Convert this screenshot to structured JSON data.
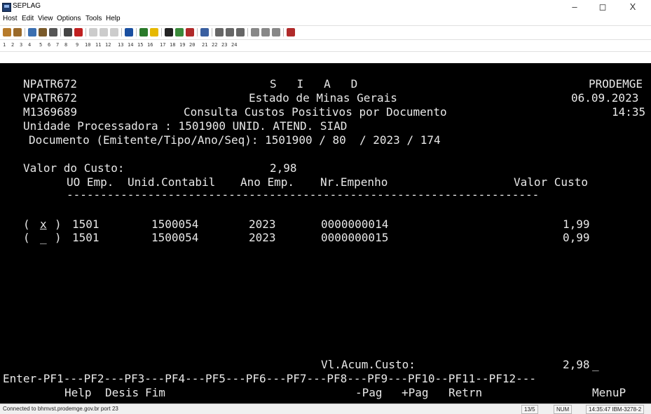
{
  "window": {
    "title": "SEPLAG",
    "minimize": "–",
    "maximize": "◻",
    "close": "X"
  },
  "menu": [
    "Host",
    "Edit",
    "View",
    "Options",
    "Tools",
    "Help"
  ],
  "pf_keys": [
    "1",
    "2",
    "3",
    "4",
    "5",
    "6",
    "7",
    "8",
    "9",
    "10",
    "11",
    "12",
    "13",
    "14",
    "15",
    "16",
    "17",
    "18",
    "19",
    "20",
    "21",
    "22",
    "23",
    "24"
  ],
  "screen": {
    "program": "NPATR672",
    "app_name": "S   I   A   D",
    "company": "PRODEMGE",
    "view_id": "VPATR672",
    "state": "Estado de Minas Gerais",
    "date": "06.09.2023",
    "user_id": "M1369689",
    "screen_title": "Consulta Custos Positivos por Documento",
    "time": "14:35",
    "unit_line": "Unidade Processadora : 1501900 UNID. ATEND. SIAD",
    "document_line": "Documento (Emitente/Tipo/Ano/Seq): 1501900 / 80  / 2023 / 174",
    "valor_label": "Valor do Custo:",
    "valor_value": "2,98",
    "columns": {
      "uo": "UO Emp.",
      "unid": "Unid.Contabil",
      "ano": "Ano Emp.",
      "empenho": "Nr.Empenho",
      "valor": "Valor Custo"
    },
    "dashes": "----------------------------------------------------------------------",
    "rows": [
      {
        "sel": "x",
        "uo": "1501",
        "unid": "1500054",
        "ano": "2023",
        "empenho": "0000000014",
        "valor": "1,99"
      },
      {
        "sel": "_",
        "uo": "1501",
        "unid": "1500054",
        "ano": "2023",
        "empenho": "0000000015",
        "valor": "0,99"
      }
    ],
    "acum_label": "Vl.Acum.Custo:",
    "acum_value": "2,98",
    "cursor": "_",
    "pf_line": "Enter-PF1---PF2---PF3---PF4---PF5---PF6---PF7---PF8---PF9---PF10--PF11--PF12---",
    "actions": {
      "pf1": "Help",
      "pf2": "Desis",
      "pf3": "Fim",
      "pf7": "-Pag",
      "pf8": "+Pag",
      "pf9": "Retrn",
      "pf12": "MenuP"
    }
  },
  "status": {
    "connection": "Connected to bhmvst.prodemge.gov.br port 23",
    "cursor_pos": "13/5",
    "num": "NUM",
    "clock_session": "14:35:47 IBM-3278-2"
  }
}
